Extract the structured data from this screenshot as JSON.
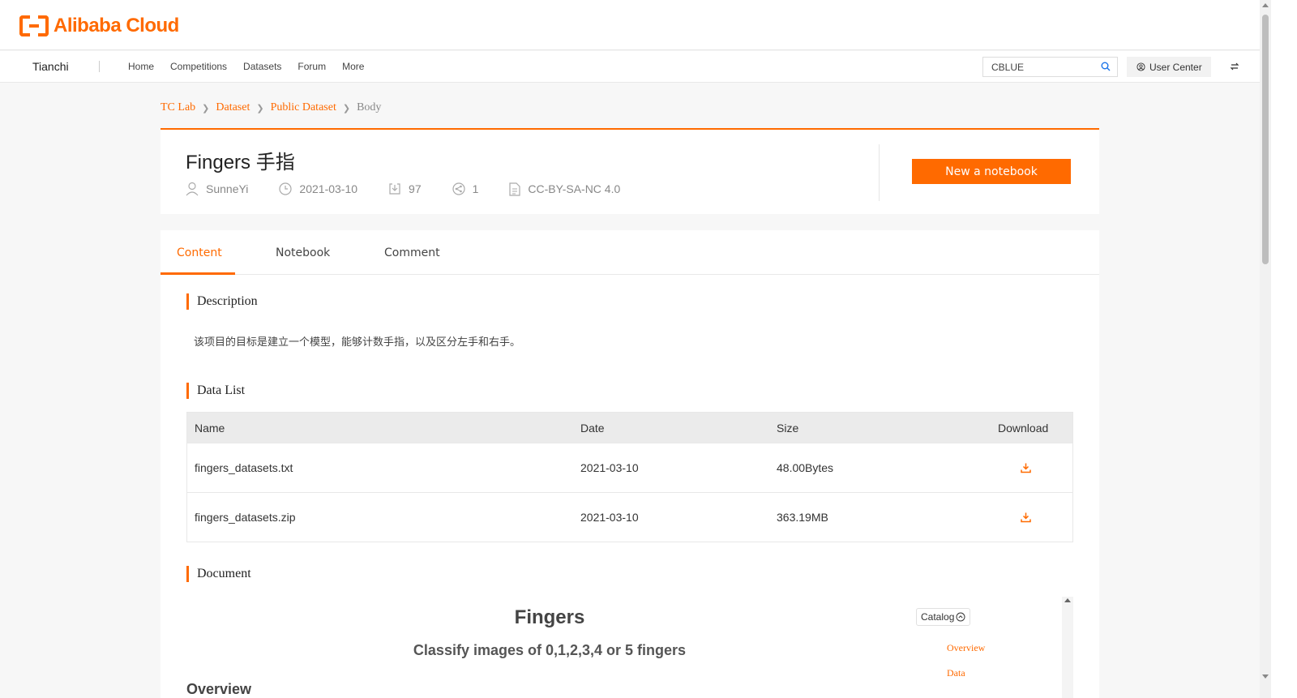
{
  "brand": {
    "logo_text": "Alibaba Cloud",
    "accent": "#ff6a00"
  },
  "nav": {
    "brand": "Tianchi",
    "links": [
      "Home",
      "Competitions",
      "Datasets",
      "Forum",
      "More"
    ],
    "search_value": "CBLUE",
    "user_center": "User Center"
  },
  "breadcrumb": [
    "TC Lab",
    "Dataset",
    "Public Dataset",
    "Body"
  ],
  "dataset": {
    "title": "Fingers 手指",
    "author": "SunneYi",
    "date": "2021-03-10",
    "downloads": "97",
    "shares": "1",
    "license": "CC-BY-SA-NC 4.0",
    "notebook_button": "New a notebook"
  },
  "tabs": [
    "Content",
    "Notebook",
    "Comment"
  ],
  "active_tab": "Content",
  "description": {
    "heading": "Description",
    "text": "该项目的目标是建立一个模型，能够计数手指，以及区分左手和右手。"
  },
  "data_list": {
    "heading": "Data List",
    "columns": [
      "Name",
      "Date",
      "Size",
      "Download"
    ],
    "rows": [
      {
        "name": "fingers_datasets.txt",
        "date": "2021-03-10",
        "size": "48.00Bytes"
      },
      {
        "name": "fingers_datasets.zip",
        "date": "2021-03-10",
        "size": "363.19MB"
      }
    ]
  },
  "document": {
    "heading": "Document",
    "title": "Fingers",
    "subtitle": "Classify images of 0,1,2,3,4 or 5 fingers",
    "partial_heading": "Overview",
    "catalog_label": "Catalog",
    "catalog_items": [
      "Overview",
      "Data"
    ]
  }
}
